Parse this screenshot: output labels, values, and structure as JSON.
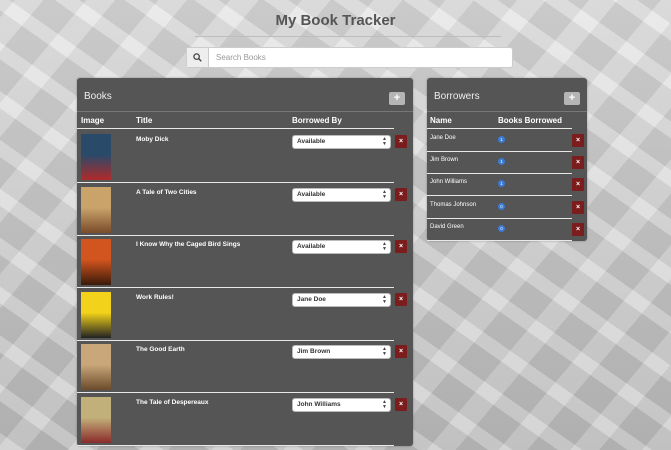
{
  "app": {
    "title": "My Book Tracker"
  },
  "search": {
    "placeholder": "Search Books"
  },
  "books_panel": {
    "title": "Books",
    "add_label": "+",
    "columns": {
      "image": "Image",
      "title": "Title",
      "borrowed_by": "Borrowed By"
    },
    "rows": [
      {
        "title": "Moby Dick",
        "borrowed_by": "Available",
        "cover_colors": [
          "#2a4a6a",
          "#b02a2a"
        ]
      },
      {
        "title": "A Tale of Two Cities",
        "borrowed_by": "Available",
        "cover_colors": [
          "#c9a36a",
          "#7a4b2a"
        ]
      },
      {
        "title": "I Know Why the Caged Bird Sings",
        "borrowed_by": "Available",
        "cover_colors": [
          "#d2541e",
          "#3a1a0a"
        ]
      },
      {
        "title": "Work Rules!",
        "borrowed_by": "Jane Doe",
        "cover_colors": [
          "#f2d21a",
          "#222222"
        ]
      },
      {
        "title": "The Good Earth",
        "borrowed_by": "Jim Brown",
        "cover_colors": [
          "#c9a77a",
          "#6a4a2a"
        ]
      },
      {
        "title": "The Tale of Despereaux",
        "borrowed_by": "John Williams",
        "cover_colors": [
          "#c2b07a",
          "#8a2a2a"
        ]
      }
    ],
    "delete_label": "×"
  },
  "borrowers_panel": {
    "title": "Borrowers",
    "add_label": "+",
    "columns": {
      "name": "Name",
      "books_borrowed": "Books Borrowed"
    },
    "rows": [
      {
        "name": "Jane Doe",
        "count": "1"
      },
      {
        "name": "Jim Brown",
        "count": "1"
      },
      {
        "name": "John Williams",
        "count": "1"
      },
      {
        "name": "Thomas Johnson",
        "count": "0"
      },
      {
        "name": "David Green",
        "count": "0"
      }
    ],
    "delete_label": "×"
  },
  "colors": {
    "panel": "#555555",
    "delete": "#7b1d1d",
    "badge": "#3a7bd5"
  },
  "icons": {
    "search": "search-icon",
    "caret": "select-caret-icon"
  }
}
